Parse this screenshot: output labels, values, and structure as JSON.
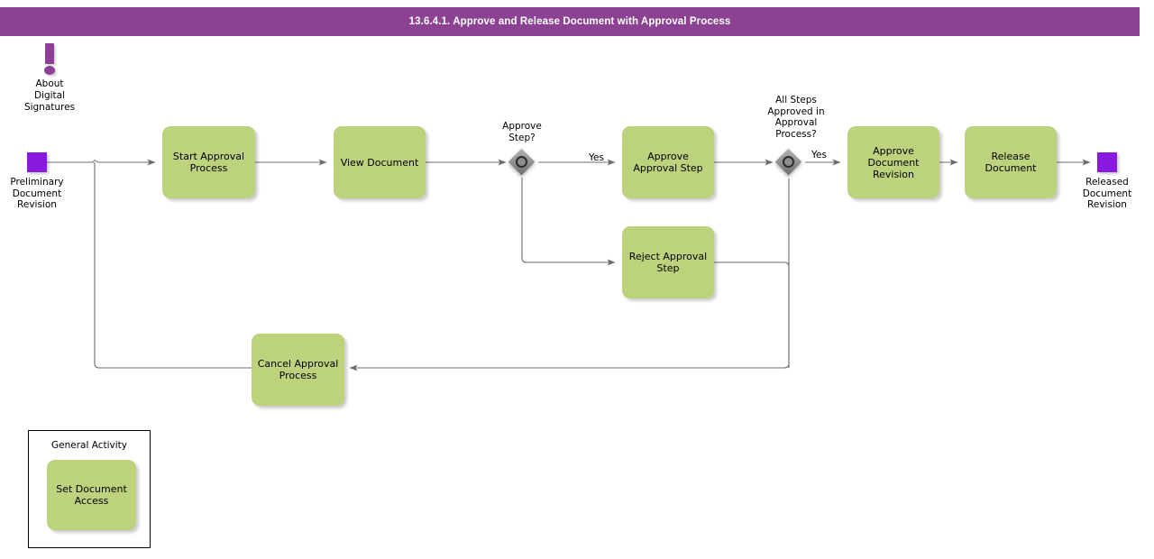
{
  "header": {
    "title": "13.6.4.1. Approve and Release Document with Approval Process",
    "bar_color": "#8c4293"
  },
  "annotation": {
    "icon": "exclamation-icon",
    "text": "About\nDigital\nSignatures",
    "color": "#8c3f94"
  },
  "palette": {
    "task_fill": "#bcd27c",
    "event_fill": "#8a19e0",
    "gateway_fill": "#8e8e8e",
    "edge_stroke": "#6b6b6b",
    "text": "#000000"
  },
  "events": [
    {
      "id": "start-event",
      "name": "preliminary-document-revision",
      "label": "Preliminary\nDocument\nRevision",
      "type": "start"
    },
    {
      "id": "end-event",
      "name": "released-document-revision",
      "label": "Released\nDocument\nRevision",
      "type": "end"
    }
  ],
  "tasks": [
    {
      "id": "start-approval-process",
      "label": "Start Approval\nProcess"
    },
    {
      "id": "view-document",
      "label": "View Document"
    },
    {
      "id": "approve-approval-step",
      "label": "Approve\nApproval Step"
    },
    {
      "id": "reject-approval-step",
      "label": "Reject Approval\nStep"
    },
    {
      "id": "approve-document-revision",
      "label": "Approve\nDocument\nRevision"
    },
    {
      "id": "release-document",
      "label": "Release\nDocument"
    },
    {
      "id": "cancel-approval-process",
      "label": "Cancel Approval\nProcess"
    }
  ],
  "gateways": [
    {
      "id": "gateway-approve-step",
      "label": "Approve\nStep?"
    },
    {
      "id": "gateway-all-steps",
      "label": "All Steps\nApproved in\nApproval\nProcess?"
    }
  ],
  "edge_labels": [
    {
      "id": "edge-label-yes-1",
      "text": "Yes"
    },
    {
      "id": "edge-label-yes-2",
      "text": "Yes"
    }
  ],
  "legend": {
    "title": "General Activity",
    "sample_task": "Set Document\nAccess"
  }
}
